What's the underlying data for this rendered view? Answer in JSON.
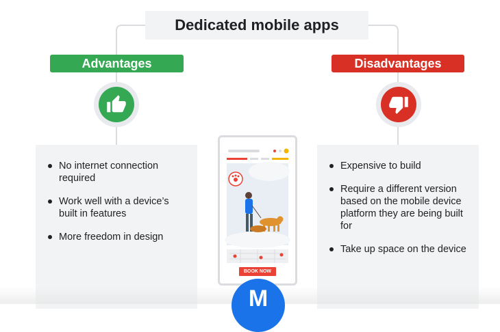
{
  "title": "Dedicated mobile apps",
  "advantages": {
    "label": "Advantages",
    "icon": "thumbs-up-icon",
    "color": "#34a853",
    "items": [
      "No internet connection required",
      "Work well with a device’s built in features",
      "More freedom in design"
    ]
  },
  "disadvantages": {
    "label": "Disadvantages",
    "icon": "thumbs-down-icon",
    "color": "#d93025",
    "items": [
      "Expensive to build",
      "Require a different version based on the mobile device platform they are being built for",
      "Take up space on the device"
    ]
  },
  "phone": {
    "book_button": "BOOK NOW"
  },
  "logo": {
    "letter": "M",
    "color": "#1a73e8"
  }
}
